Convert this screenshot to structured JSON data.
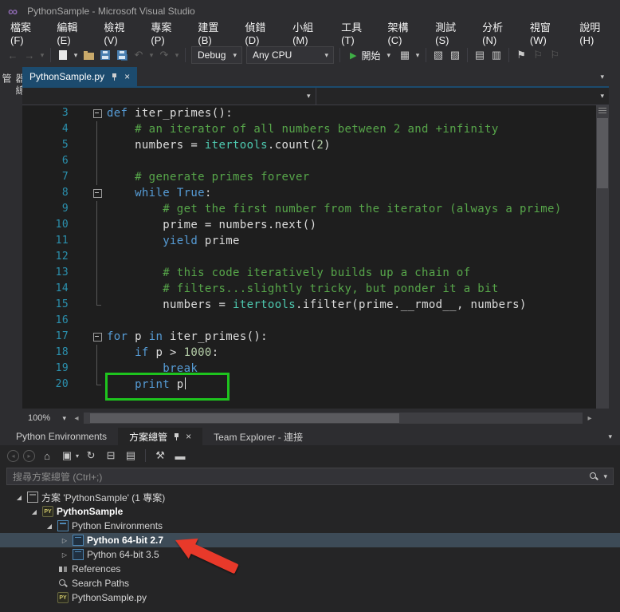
{
  "window": {
    "title": "PythonSample - Microsoft Visual Studio"
  },
  "menu_items": [
    "檔案(F)",
    "編輯(E)",
    "檢視(V)",
    "專案(P)",
    "建置(B)",
    "偵錯(D)",
    "小組(M)",
    "工具(T)",
    "架構(C)",
    "測試(S)",
    "分析(N)",
    "視窗(W)",
    "說明(H)"
  ],
  "toolbar": {
    "debug_target": "Debug",
    "platform": "Any CPU",
    "start_label": "開始"
  },
  "editor": {
    "side_tab_label": "伺服器總管",
    "tab_label": "PythonSample.py",
    "zoom_level": "100%",
    "code_lines": [
      {
        "num": 3,
        "outline": "minus",
        "segments": [
          [
            "kw",
            "def"
          ],
          [
            "pl",
            " iter_primes():"
          ]
        ]
      },
      {
        "num": 4,
        "outline": "line",
        "segments": [
          [
            "com",
            "    # an iterator of all numbers between 2 and +infinity"
          ]
        ]
      },
      {
        "num": 5,
        "outline": "line",
        "segments": [
          [
            "pl",
            "    numbers = "
          ],
          [
            "typ",
            "itertools"
          ],
          [
            "pl",
            ".count("
          ],
          [
            "num",
            "2"
          ],
          [
            "pl",
            ")"
          ]
        ]
      },
      {
        "num": 6,
        "outline": "line",
        "segments": []
      },
      {
        "num": 7,
        "outline": "line",
        "segments": [
          [
            "com",
            "    # generate primes forever"
          ]
        ]
      },
      {
        "num": 8,
        "outline": "minus",
        "segments": [
          [
            "pl",
            "    "
          ],
          [
            "kw",
            "while"
          ],
          [
            "pl",
            " "
          ],
          [
            "kw",
            "True"
          ],
          [
            "pl",
            ":"
          ]
        ]
      },
      {
        "num": 9,
        "outline": "line",
        "segments": [
          [
            "com",
            "        # get the first number from the iterator (always a prime)"
          ]
        ]
      },
      {
        "num": 10,
        "outline": "line",
        "segments": [
          [
            "pl",
            "        prime = numbers.next()"
          ]
        ]
      },
      {
        "num": 11,
        "outline": "line",
        "segments": [
          [
            "pl",
            "        "
          ],
          [
            "kw",
            "yield"
          ],
          [
            "pl",
            " prime"
          ]
        ]
      },
      {
        "num": 12,
        "outline": "line",
        "segments": []
      },
      {
        "num": 13,
        "outline": "line",
        "segments": [
          [
            "com",
            "        # this code iteratively builds up a chain of"
          ]
        ]
      },
      {
        "num": 14,
        "outline": "line",
        "segments": [
          [
            "com",
            "        # filters...slightly tricky, but ponder it a bit"
          ]
        ]
      },
      {
        "num": 15,
        "outline": "end",
        "segments": [
          [
            "pl",
            "        numbers = "
          ],
          [
            "typ",
            "itertools"
          ],
          [
            "pl",
            ".ifilter(prime.__rmod__, numbers)"
          ]
        ]
      },
      {
        "num": 16,
        "outline": "none",
        "segments": []
      },
      {
        "num": 17,
        "outline": "minus",
        "segments": [
          [
            "kw",
            "for"
          ],
          [
            "pl",
            " p "
          ],
          [
            "kw",
            "in"
          ],
          [
            "pl",
            " iter_primes():"
          ]
        ]
      },
      {
        "num": 18,
        "outline": "line",
        "segments": [
          [
            "pl",
            "    "
          ],
          [
            "kw",
            "if"
          ],
          [
            "pl",
            " p > "
          ],
          [
            "num",
            "1000"
          ],
          [
            "pl",
            ":"
          ]
        ]
      },
      {
        "num": 19,
        "outline": "line",
        "segments": [
          [
            "pl",
            "        "
          ],
          [
            "kw",
            "break"
          ]
        ]
      },
      {
        "num": 20,
        "outline": "end",
        "segments": [
          [
            "pl",
            "    "
          ],
          [
            "kw",
            "print"
          ],
          [
            "pl",
            " p"
          ]
        ],
        "cursor": true,
        "highlight": true
      }
    ]
  },
  "panel": {
    "tabs": [
      {
        "label": "Python Environments",
        "active": false
      },
      {
        "label": "方案總管",
        "active": true
      },
      {
        "label": "Team Explorer - 連接",
        "active": false
      }
    ],
    "search_placeholder": "搜尋方案總管 (Ctrl+;)",
    "tree_items": [
      {
        "label": "方案 'PythonSample' (1 專案)",
        "depth": 0,
        "icon": "solution",
        "expander": "expanded",
        "bold": false,
        "selected": false
      },
      {
        "label": "PythonSample",
        "depth": 1,
        "icon": "py-project",
        "expander": "expanded",
        "bold": true,
        "selected": false
      },
      {
        "label": "Python Environments",
        "depth": 2,
        "icon": "environments",
        "expander": "expanded",
        "bold": false,
        "selected": false
      },
      {
        "label": "Python 64-bit 2.7",
        "depth": 3,
        "icon": "environment",
        "expander": "collapsed",
        "bold": true,
        "selected": true
      },
      {
        "label": "Python 64-bit 3.5",
        "depth": 3,
        "icon": "environment",
        "expander": "collapsed",
        "bold": false,
        "selected": false
      },
      {
        "label": "References",
        "depth": 2,
        "icon": "references",
        "expander": "none",
        "bold": false,
        "selected": false
      },
      {
        "label": "Search Paths",
        "depth": 2,
        "icon": "search-paths",
        "expander": "none",
        "bold": false,
        "selected": false
      },
      {
        "label": "PythonSample.py",
        "depth": 2,
        "icon": "py-file",
        "expander": "none",
        "bold": false,
        "selected": false
      }
    ]
  },
  "annotations": {
    "highlight_box_around": "print p",
    "arrow_points_to": "Python 64-bit 2.7"
  },
  "icons": {
    "logo": "∞",
    "dropdown": "▾",
    "close": "×",
    "nav_back": "←",
    "nav_forward": "→",
    "undo": "↶",
    "redo": "↷",
    "start_play": "▶",
    "attach": "▦",
    "window_a": "▧",
    "window_b": "▨",
    "list_a": "▤",
    "list_b": "▥",
    "bookmark": "⚑",
    "flag": "⚐",
    "panel_back": "◂",
    "panel_forward": "▸",
    "home": "⌂",
    "scope": "▣",
    "sync": "↻",
    "collapse_all": "⊟",
    "properties": "▤",
    "wrench": "⚒",
    "bar": "▬",
    "scroll_left": "◂",
    "scroll_right": "▸",
    "expanded": "◢",
    "collapsed": "▷",
    "py_badge": "PY"
  },
  "colors": {
    "keyword": "#569cd6",
    "comment": "#57a64a",
    "module": "#4ec9b0",
    "number": "#b5cea8",
    "code_text": "#dcdcdc",
    "line_number": "#2b91af",
    "active_tab": "#1c4b6e",
    "highlight_green": "#1ec41e",
    "arrow_red": "#e8392a",
    "accent_blue": "#007acc"
  }
}
